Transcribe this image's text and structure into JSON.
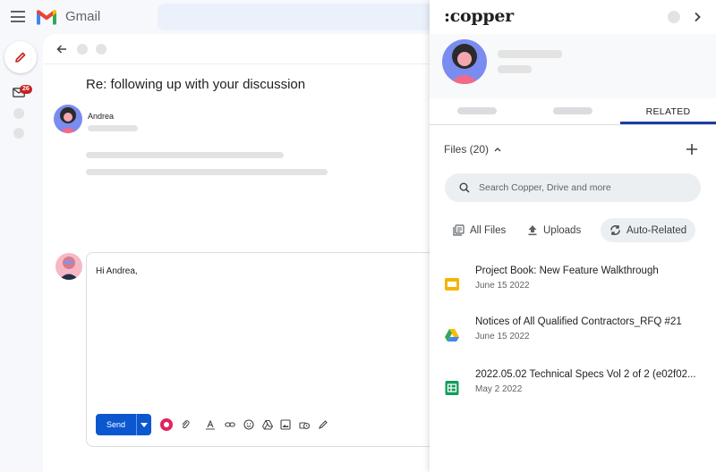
{
  "gmail": {
    "app_name": "Gmail",
    "unread_count": "26",
    "thread": {
      "subject": "Re: following up with your discussion",
      "sender": "Andrea"
    },
    "reply": {
      "body": "Hi Andrea,",
      "send_label": "Send"
    }
  },
  "copper": {
    "logo_dots": ":",
    "logo_text": "copper",
    "tabs": {
      "related_label": "RELATED"
    },
    "files_header": "Files (20)",
    "search_placeholder": "Search Copper, Drive and more",
    "filters": {
      "all_files": "All Files",
      "uploads": "Uploads",
      "auto_related": "Auto-Related"
    },
    "files": [
      {
        "title": "Project Book: New Feature Walkthrough",
        "date": "June 15 2022",
        "icon": "slides-icon"
      },
      {
        "title": "Notices of All Qualified Contractors_RFQ #21",
        "date": "June 15 2022",
        "icon": "drive-icon"
      },
      {
        "title": "2022.05.02 Technical Specs Vol 2 of 2 (e02f02...",
        "date": "May 2 2022",
        "icon": "sheets-icon"
      }
    ]
  },
  "colors": {
    "gmail_red": "#ea4335",
    "send_blue": "#0b57d0",
    "tab_underline": "#1a3ea0",
    "slides_yellow": "#f4b400",
    "sheets_green": "#0f9d58"
  }
}
